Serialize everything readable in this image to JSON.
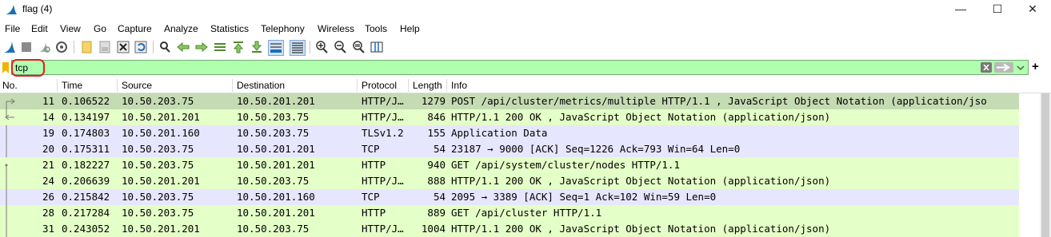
{
  "window": {
    "title": "flag (4)",
    "minimize": "—",
    "maximize": "☐",
    "close": "✕"
  },
  "menu": [
    "File",
    "Edit",
    "View",
    "Go",
    "Capture",
    "Analyze",
    "Statistics",
    "Telephony",
    "Wireless",
    "Tools",
    "Help"
  ],
  "filter": {
    "value": "tcp",
    "add_label": "+"
  },
  "columns": [
    "No.",
    "Time",
    "Source",
    "Destination",
    "Protocol",
    "Length",
    "Info"
  ],
  "colors": {
    "http_row": "#e4ffc7",
    "tcp_row": "#e7e6ff",
    "selected_row": "#c5dbb3",
    "filter_bg": "#afffaf",
    "annotation": "#e02020"
  },
  "packets": [
    {
      "no": "11",
      "time": "0.106522",
      "src": "10.50.203.75",
      "dst": "10.50.201.201",
      "proto": "HTTP/J…",
      "len": "1279",
      "info": "POST /api/cluster/metrics/multiple HTTP/1.1 , JavaScript Object Notation (application/jso",
      "kind": "selected"
    },
    {
      "no": "14",
      "time": "0.134197",
      "src": "10.50.201.201",
      "dst": "10.50.203.75",
      "proto": "HTTP/J…",
      "len": "846",
      "info": "HTTP/1.1 200 OK , JavaScript Object Notation (application/json)",
      "kind": "http"
    },
    {
      "no": "19",
      "time": "0.174803",
      "src": "10.50.201.160",
      "dst": "10.50.203.75",
      "proto": "TLSv1.2",
      "len": "155",
      "info": "Application Data",
      "kind": "tcp"
    },
    {
      "no": "20",
      "time": "0.175311",
      "src": "10.50.203.75",
      "dst": "10.50.201.201",
      "proto": "TCP",
      "len": "54",
      "info": "23187 → 9000 [ACK] Seq=1226 Ack=793 Win=64 Len=0",
      "kind": "tcp"
    },
    {
      "no": "21",
      "time": "0.182227",
      "src": "10.50.203.75",
      "dst": "10.50.201.201",
      "proto": "HTTP",
      "len": "940",
      "info": "GET /api/system/cluster/nodes HTTP/1.1",
      "kind": "http"
    },
    {
      "no": "24",
      "time": "0.206639",
      "src": "10.50.201.201",
      "dst": "10.50.203.75",
      "proto": "HTTP/J…",
      "len": "888",
      "info": "HTTP/1.1 200 OK , JavaScript Object Notation (application/json)",
      "kind": "http"
    },
    {
      "no": "26",
      "time": "0.215842",
      "src": "10.50.203.75",
      "dst": "10.50.201.160",
      "proto": "TCP",
      "len": "54",
      "info": "2095 → 3389 [ACK] Seq=1 Ack=102 Win=59 Len=0",
      "kind": "tcp"
    },
    {
      "no": "28",
      "time": "0.217284",
      "src": "10.50.203.75",
      "dst": "10.50.201.201",
      "proto": "HTTP",
      "len": "889",
      "info": "GET /api/cluster HTTP/1.1",
      "kind": "http"
    },
    {
      "no": "31",
      "time": "0.243052",
      "src": "10.50.201.201",
      "dst": "10.50.203.75",
      "proto": "HTTP/J…",
      "len": "1004",
      "info": "HTTP/1.1 200 OK , JavaScript Object Notation (application/json)",
      "kind": "http"
    }
  ]
}
